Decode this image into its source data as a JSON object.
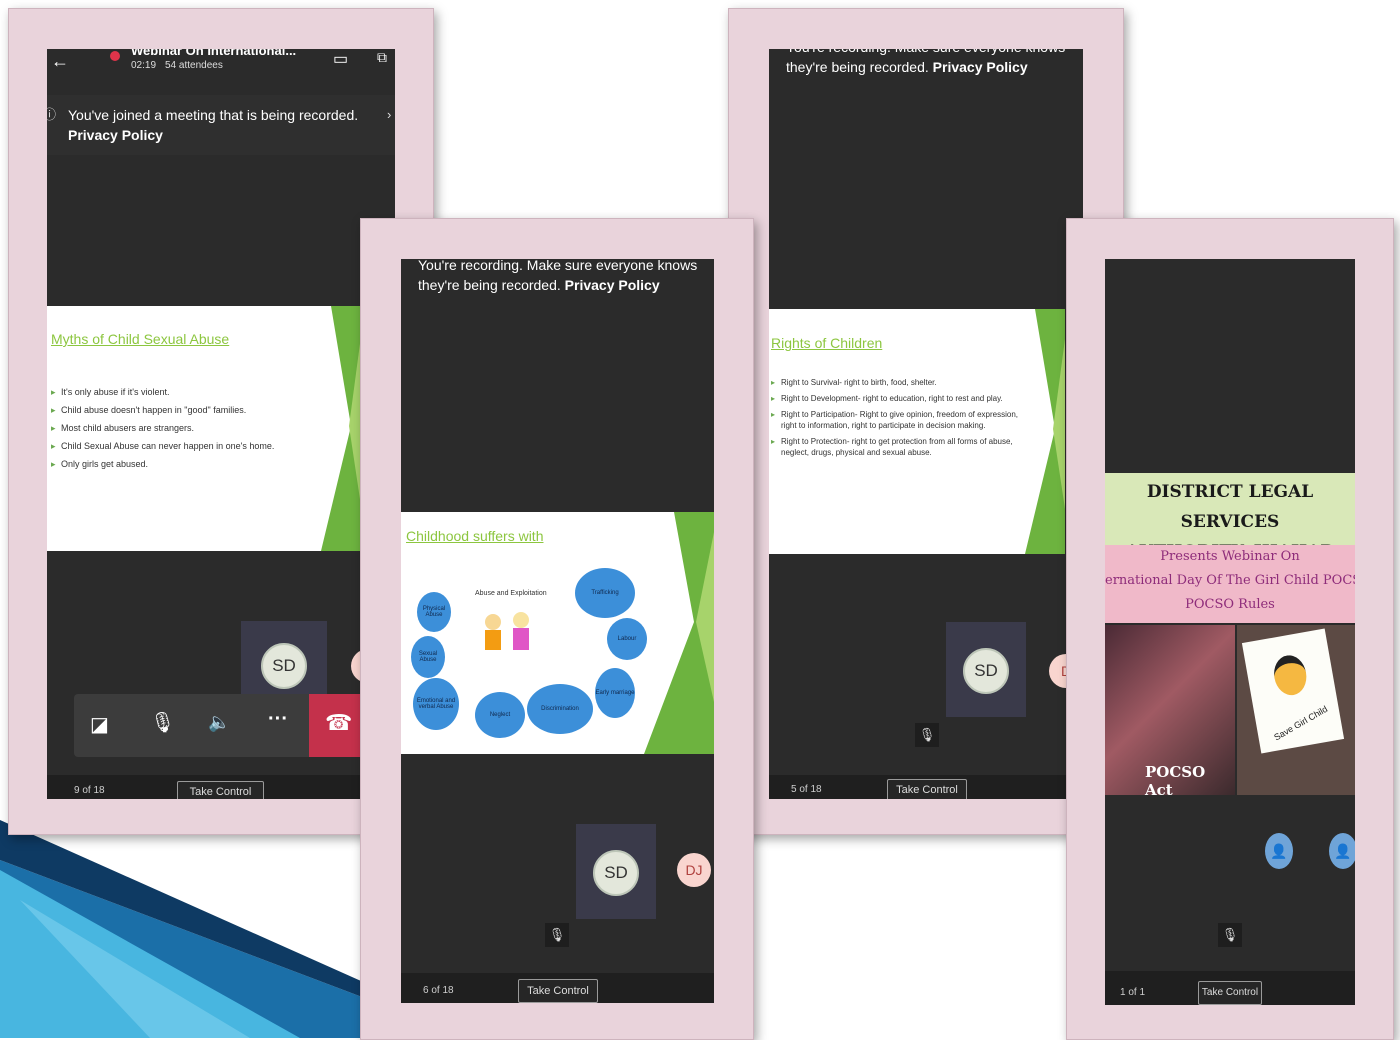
{
  "window1": {
    "title": "Webinar On International...",
    "timer": "02:19",
    "attendees": "54 attendees",
    "notice_text": "You've joined a meeting that is being recorded.",
    "notice_link": "Privacy Policy",
    "slide_title": "Myths of Child Sexual Abuse",
    "bullets": [
      "It's only abuse if it's violent.",
      "Child abuse doesn't happen in \"good\" families.",
      "Most child abusers are strangers.",
      "Child Sexual Abuse can never happen in one's home.",
      "Only girls get abused."
    ],
    "avatar": "SD",
    "page": "9 of 18",
    "take_control": "Take Control"
  },
  "window2": {
    "notice_text": "You're recording. Make sure everyone knows they're being recorded.",
    "notice_link": "Privacy Policy",
    "slide_title": "Childhood suffers with",
    "center_label": "Abuse and Exploitation",
    "bubbles": [
      "Physical Abuse",
      "Sexual Abuse",
      "Emotional and verbal Abuse",
      "Neglect",
      "Discrimination",
      "Early marriage",
      "Labour",
      "Trafficking"
    ],
    "avatar_sd": "SD",
    "avatar_dj": "DJ",
    "page": "6 of 18",
    "take_control": "Take Control"
  },
  "window3": {
    "notice_text": "You're recording. Make sure everyone knows they're being recorded.",
    "notice_link": "Privacy Policy",
    "slide_title": "Rights of Children",
    "bullets": [
      "Right to Survival- right to birth, food, shelter.",
      "Right to Development- right to education, right to rest and play.",
      "Right to Participation- Right to give opinion, freedom of expression, right to information, right to participate in decision making.",
      "Right to Protection- right to get protection from all forms of abuse, neglect, drugs, physical and sexual abuse."
    ],
    "avatar": "SD",
    "partial_avatar": "D",
    "page": "5 of 18",
    "take_control": "Take Control"
  },
  "window4": {
    "banner_line1": "DISTRICT LEGAL SERVICES",
    "banner_line2": "AUTHORITY, JHAJJAR",
    "subtitle1": "Presents Webinar On",
    "subtitle2": "ernational Day Of The Girl Child POCSO Ac",
    "subtitle3": "POCSO Rules",
    "photo_caption_left": "POCSO Act",
    "photo_caption_right": "Save Girl Child",
    "page": "1 of 1",
    "take_control": "Take Control"
  },
  "colors": {
    "frame": "#e9d3db",
    "screen": "#2b2b2b",
    "slide_accent": "#8cc63f",
    "hangup": "#c4314b",
    "banner_green": "#d9e8b8",
    "banner_pink": "#f0b9c9"
  }
}
